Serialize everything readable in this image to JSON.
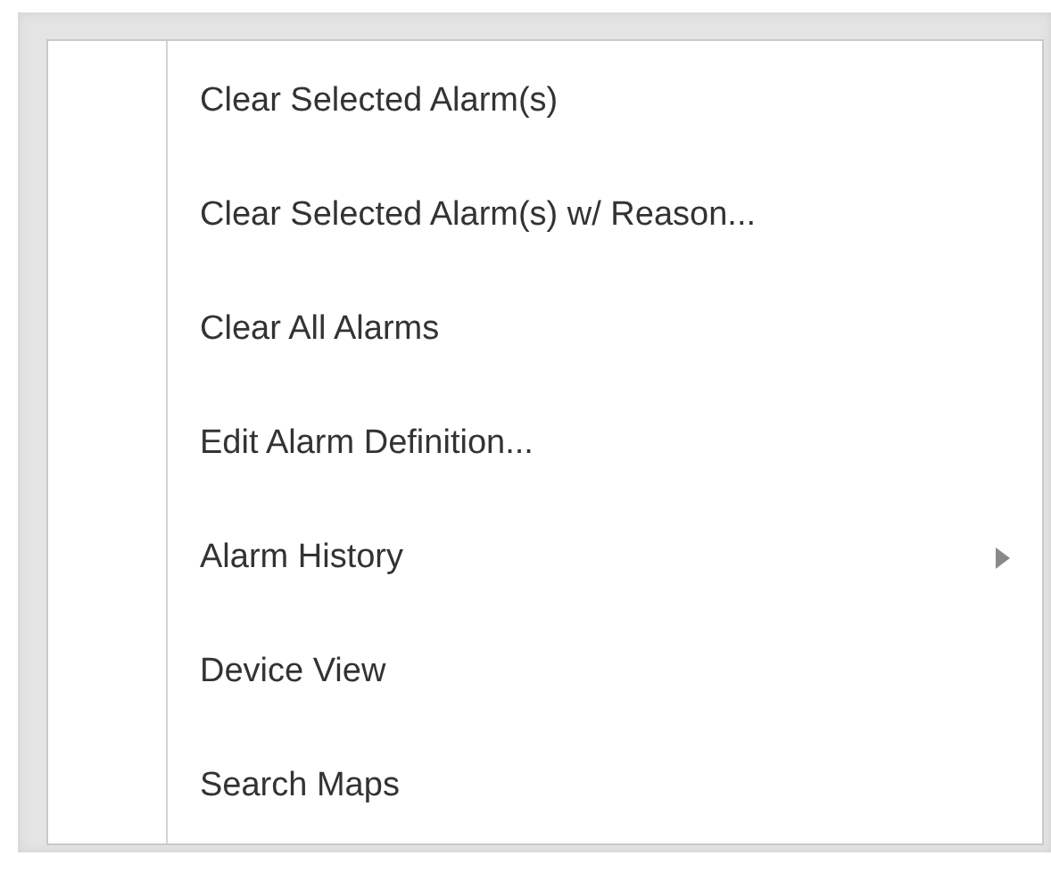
{
  "menu": {
    "items": [
      {
        "label": "Clear Selected Alarm(s)",
        "has_submenu": false
      },
      {
        "label": "Clear Selected Alarm(s) w/ Reason...",
        "has_submenu": false
      },
      {
        "label": "Clear All Alarms",
        "has_submenu": false
      },
      {
        "label": "Edit Alarm Definition...",
        "has_submenu": false
      },
      {
        "label": "Alarm History",
        "has_submenu": true
      },
      {
        "label": "Device View",
        "has_submenu": false
      },
      {
        "label": "Search Maps",
        "has_submenu": false
      }
    ]
  }
}
